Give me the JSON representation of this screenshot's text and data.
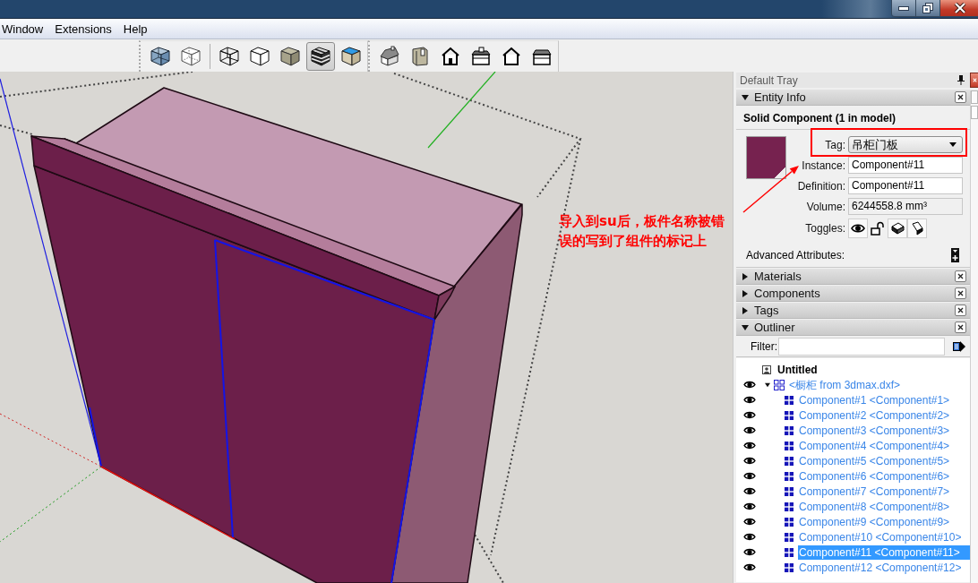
{
  "menu_bar": {
    "items": [
      "Window",
      "Extensions",
      "Help"
    ]
  },
  "toolbars": [
    {
      "sections": [
        [
          {
            "kind": "xray",
            "selected": false
          },
          {
            "kind": "back_edges",
            "selected": false
          }
        ],
        [
          {
            "kind": "wireframe",
            "selected": false
          },
          {
            "kind": "hidden_line",
            "selected": false
          },
          {
            "kind": "shaded",
            "selected": false
          },
          {
            "kind": "shaded_textures",
            "selected": true
          },
          {
            "kind": "monochrome",
            "selected": false
          }
        ]
      ]
    },
    {
      "sections": [
        [
          {
            "kind": "iso",
            "selected": false
          },
          {
            "kind": "top",
            "selected": false
          },
          {
            "kind": "front",
            "selected": false
          },
          {
            "kind": "right",
            "selected": false
          },
          {
            "kind": "back",
            "selected": false
          },
          {
            "kind": "left",
            "selected": false
          }
        ]
      ]
    }
  ],
  "tray": {
    "title": "Default Tray",
    "panels": [
      {
        "title": "Entity Info",
        "expanded": true,
        "entity_info": {
          "heading": "Solid Component (1 in model)",
          "fields": [
            {
              "kind": "dropdown",
              "label": "Tag:",
              "value": "吊柜门板"
            },
            {
              "kind": "text",
              "label": "Instance:",
              "value": "Component#11"
            },
            {
              "kind": "text",
              "label": "Definition:",
              "value": "Component#11"
            },
            {
              "kind": "readonly",
              "label": "Volume:",
              "value": "6244558.8 mm³"
            }
          ],
          "toggles": {
            "label": "Toggles:",
            "items": [
              {
                "kind": "visible",
                "on": true
              },
              {
                "kind": "lock",
                "on": false
              },
              {
                "kind": "cast_shadows",
                "on": true
              },
              {
                "kind": "receive_shadows",
                "on": true
              }
            ]
          },
          "advanced_label": "Advanced Attributes:"
        }
      },
      {
        "title": "Materials",
        "expanded": false
      },
      {
        "title": "Components",
        "expanded": false
      },
      {
        "title": "Tags",
        "expanded": false
      },
      {
        "title": "Outliner",
        "expanded": true,
        "outliner": {
          "filter": {
            "label": "Filter:"
          },
          "tree": [
            {
              "kind": "model",
              "label": "Untitled",
              "selected": false,
              "children": [
                {
                  "kind": "group",
                  "label": "<橱柜 from 3dmax.dxf>",
                  "visible": true,
                  "expanded": true,
                  "selected": false,
                  "children": [
                    {
                      "kind": "component",
                      "label": "Component#1 <Component#1>",
                      "visible": true,
                      "selected": false
                    },
                    {
                      "kind": "component",
                      "label": "Component#2 <Component#2>",
                      "visible": true,
                      "selected": false
                    },
                    {
                      "kind": "component",
                      "label": "Component#3 <Component#3>",
                      "visible": true,
                      "selected": false
                    },
                    {
                      "kind": "component",
                      "label": "Component#4 <Component#4>",
                      "visible": true,
                      "selected": false
                    },
                    {
                      "kind": "component",
                      "label": "Component#5 <Component#5>",
                      "visible": true,
                      "selected": false
                    },
                    {
                      "kind": "component",
                      "label": "Component#6 <Component#6>",
                      "visible": true,
                      "selected": false
                    },
                    {
                      "kind": "component",
                      "label": "Component#7 <Component#7>",
                      "visible": true,
                      "selected": false
                    },
                    {
                      "kind": "component",
                      "label": "Component#8 <Component#8>",
                      "visible": true,
                      "selected": false
                    },
                    {
                      "kind": "component",
                      "label": "Component#9 <Component#9>",
                      "visible": true,
                      "selected": false
                    },
                    {
                      "kind": "component",
                      "label": "Component#10 <Component#10>",
                      "visible": true,
                      "selected": false
                    },
                    {
                      "kind": "component",
                      "label": "Component#11 <Component#11>",
                      "visible": true,
                      "selected": true
                    },
                    {
                      "kind": "component",
                      "label": "Component#12 <Component#12>",
                      "visible": true,
                      "selected": false
                    }
                  ]
                }
              ]
            }
          ]
        }
      }
    ]
  },
  "annotation": {
    "text": "导入到su后，板件名称被错误的写到了组件的标记上"
  }
}
